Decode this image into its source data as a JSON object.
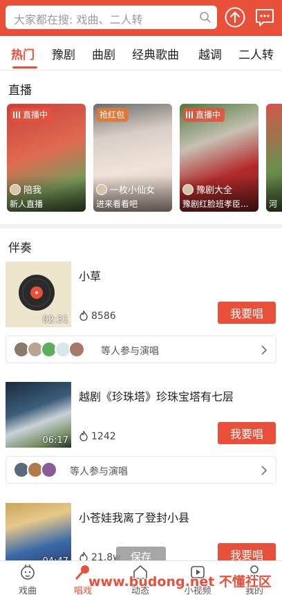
{
  "header": {
    "search_placeholder": "大家都在搜: 戏曲、二人转",
    "icons": [
      "search-icon",
      "upload-icon",
      "message-icon"
    ],
    "accent_color": "#e8503a"
  },
  "tabs": [
    "热门",
    "豫剧",
    "曲剧",
    "经典歌曲",
    "越调",
    "二人转"
  ],
  "live": {
    "title": "直播",
    "cards": [
      {
        "badge": "直播中",
        "anchor": "陪我",
        "subtitle": "新人直播"
      },
      {
        "badge": "抢红包",
        "anchor": "一枚小仙女",
        "subtitle": "进来看看吧"
      },
      {
        "badge": "直播中",
        "anchor": "豫剧大全",
        "subtitle": "豫剧红脸班孝臣..."
      },
      {
        "badge": "",
        "anchor": "",
        "subtitle": "河"
      }
    ]
  },
  "accompaniment": {
    "title": "伴奏",
    "songs": [
      {
        "title": "小草",
        "duration": "02:31",
        "count": "8586",
        "button": "我要唱",
        "participants": "等人参与演唱"
      },
      {
        "title": "越剧《珍珠塔》珍珠宝塔有七层",
        "duration": "06:17",
        "count": "1242",
        "button": "我要唱",
        "participants": "等人参与演唱"
      },
      {
        "title": "小苍娃我离了登封小县",
        "duration": "04:47",
        "count": "21.8w",
        "button": "我要唱",
        "participants": ""
      }
    ]
  },
  "toast": "保存",
  "tabbar": {
    "items": [
      {
        "label": "戏曲",
        "icon": "opera-face-icon"
      },
      {
        "label": "唱戏",
        "icon": "microphone-icon"
      },
      {
        "label": "动态",
        "icon": "home-icon"
      },
      {
        "label": "小视频",
        "icon": "video-icon"
      },
      {
        "label": "我的",
        "icon": "user-icon"
      }
    ],
    "active_index": 1
  },
  "watermark": "www.budong.net 不懂社区"
}
